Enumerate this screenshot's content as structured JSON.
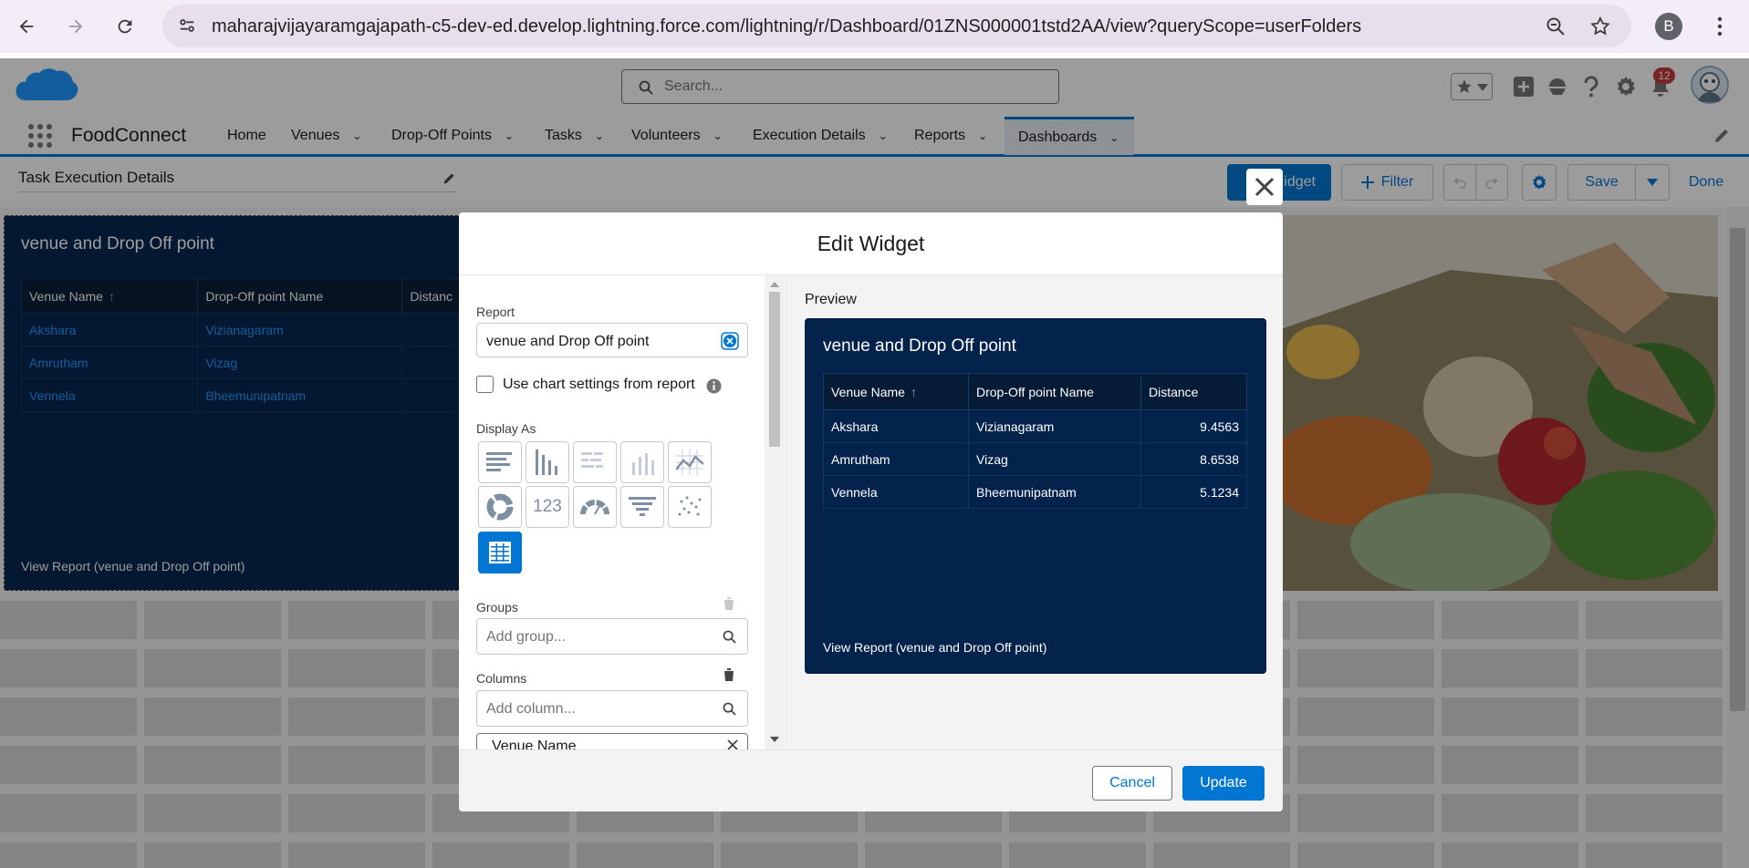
{
  "browser": {
    "url": "maharajvijayaramgajapath-c5-dev-ed.develop.lightning.force.com/lightning/r/Dashboard/01ZNS000001tstd2AA/view?queryScope=userFolders",
    "profile_initial": "B"
  },
  "header": {
    "search_placeholder": "Search...",
    "notification_count": "12"
  },
  "nav": {
    "app_name": "FoodConnect",
    "items": [
      {
        "label": "Home"
      },
      {
        "label": "Venues"
      },
      {
        "label": "Drop-Off Points"
      },
      {
        "label": "Tasks"
      },
      {
        "label": "Volunteers"
      },
      {
        "label": "Execution Details"
      },
      {
        "label": "Reports"
      },
      {
        "label": "Dashboards"
      }
    ]
  },
  "toolbar": {
    "dashboard_name": "Task Execution Details",
    "widget_label": "idget",
    "filter_label": "Filter",
    "save_label": "Save",
    "done_label": "Done"
  },
  "background_widget": {
    "title": "venue and Drop Off point",
    "columns": [
      "Venue Name",
      "Drop-Off point Name",
      "Distanc"
    ],
    "rows": [
      [
        "Akshara",
        "Vizianagaram"
      ],
      [
        "Amrutham",
        "Vizag"
      ],
      [
        "Vennela",
        "Bheemunipatnam"
      ]
    ],
    "footer": "View Report (venue and Drop Off point)"
  },
  "modal": {
    "title": "Edit Widget",
    "report_label": "Report",
    "report_value": "venue and Drop Off point",
    "use_chart_settings_label": "Use chart settings from report",
    "display_as_label": "Display As",
    "display_as_options": [
      "horizontal-bar",
      "vertical-bar",
      "stacked-horizontal-bar",
      "stacked-vertical-bar",
      "line",
      "donut",
      "metric",
      "gauge",
      "funnel",
      "scatter",
      "lightning-table"
    ],
    "display_as_selected": "lightning-table",
    "groups_label": "Groups",
    "groups_placeholder": "Add group...",
    "columns_label": "Columns",
    "columns_placeholder": "Add column...",
    "column_chip": "Venue Name",
    "preview_label": "Preview",
    "cancel_label": "Cancel",
    "update_label": "Update"
  },
  "preview": {
    "title": "venue and Drop Off point",
    "columns": [
      "Venue Name",
      "Drop-Off point Name",
      "Distance"
    ],
    "rows": [
      [
        "Akshara",
        "Vizianagaram",
        "9.4563"
      ],
      [
        "Amrutham",
        "Vizag",
        "8.6538"
      ],
      [
        "Vennela",
        "Bheemunipatnam",
        "5.1234"
      ]
    ],
    "footer": "View Report (venue and Drop Off point)"
  },
  "colors": {
    "brand": "#0176d3",
    "widget_bg": "#03234d",
    "link": "#1b96ff"
  }
}
